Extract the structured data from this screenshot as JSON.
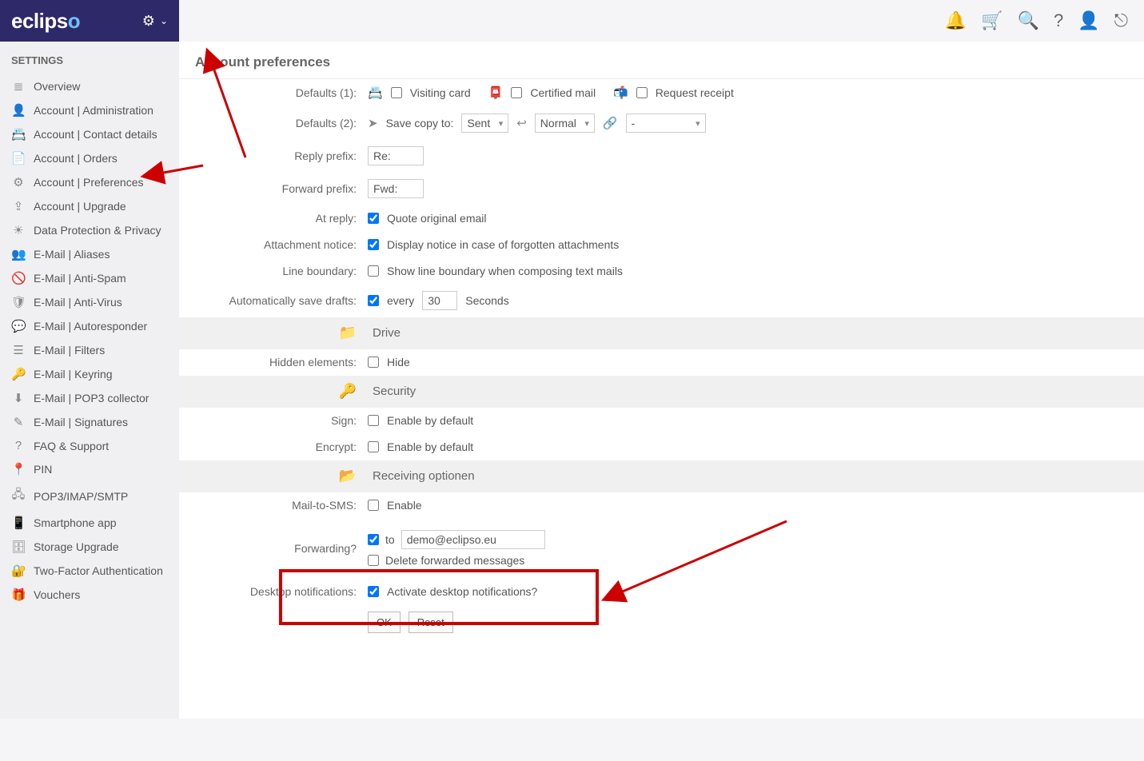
{
  "brand": "eclipso",
  "sidebar": {
    "title": "SETTINGS",
    "items": [
      {
        "label": "Overview"
      },
      {
        "label": "Account | Administration"
      },
      {
        "label": "Account | Contact details"
      },
      {
        "label": "Account | Orders"
      },
      {
        "label": "Account | Preferences"
      },
      {
        "label": "Account | Upgrade"
      },
      {
        "label": "Data Protection & Privacy"
      },
      {
        "label": "E-Mail | Aliases"
      },
      {
        "label": "E-Mail | Anti-Spam"
      },
      {
        "label": "E-Mail | Anti-Virus"
      },
      {
        "label": "E-Mail | Autoresponder"
      },
      {
        "label": "E-Mail | Filters"
      },
      {
        "label": "E-Mail | Keyring"
      },
      {
        "label": "E-Mail | POP3 collector"
      },
      {
        "label": "E-Mail | Signatures"
      },
      {
        "label": "FAQ & Support"
      },
      {
        "label": "PIN"
      },
      {
        "label": "POP3/IMAP/SMTP"
      },
      {
        "label": "Smartphone app"
      },
      {
        "label": "Storage Upgrade"
      },
      {
        "label": "Two-Factor Authentication"
      },
      {
        "label": "Vouchers"
      }
    ]
  },
  "page": {
    "title": "Account preferences"
  },
  "labels": {
    "defaults1": "Defaults (1):",
    "defaults2": "Defaults (2):",
    "reply_prefix": "Reply prefix:",
    "forward_prefix": "Forward prefix:",
    "at_reply": "At reply:",
    "attachment_notice": "Attachment notice:",
    "line_boundary": "Line boundary:",
    "auto_save": "Automatically save drafts:",
    "hidden_elements": "Hidden elements:",
    "sign": "Sign:",
    "encrypt": "Encrypt:",
    "mail_to_sms": "Mail-to-SMS:",
    "forwarding": "Forwarding?",
    "desktop_notifications": "Desktop notifications:"
  },
  "options": {
    "visiting_card": "Visiting card",
    "certified_mail": "Certified mail",
    "request_receipt": "Request receipt",
    "save_copy_to": "Save copy to:",
    "sent": "Sent",
    "normal": "Normal",
    "dash": "-",
    "quote_original": "Quote original email",
    "attachment_notice_text": "Display notice in case of forgotten attachments",
    "line_boundary_text": "Show line boundary when composing text mails",
    "auto_save_every": "every",
    "auto_save_seconds": "Seconds",
    "hide": "Hide",
    "enable_default": "Enable by default",
    "enable": "Enable",
    "to": "to",
    "delete_forwarded": "Delete forwarded messages",
    "desktop_notif_text": "Activate desktop notifications?"
  },
  "values": {
    "reply_prefix": "Re:",
    "forward_prefix": "Fwd:",
    "auto_save_seconds": "30",
    "forward_email": "demo@eclipso.eu"
  },
  "sections": {
    "drive": "Drive",
    "security": "Security",
    "receiving": "Receiving optionen"
  },
  "buttons": {
    "ok": "OK",
    "reset": "Reset"
  }
}
